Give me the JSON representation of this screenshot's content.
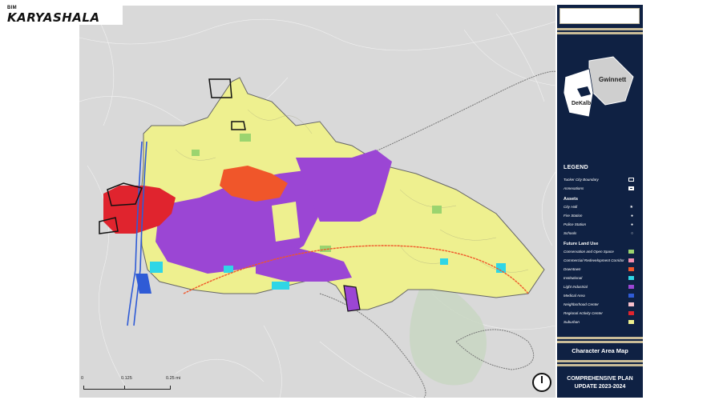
{
  "logo": {
    "small": "BIM",
    "name": "KARYASHALA"
  },
  "scale": {
    "ticks": [
      "0",
      "0.125",
      "0.25 mi"
    ]
  },
  "inset": {
    "county_a": "Gwinnett",
    "county_b": "DeKalb"
  },
  "legend": {
    "title": "LEGEND",
    "boundaries": [
      {
        "label": "Tucker City Boundary",
        "style": "outline"
      },
      {
        "label": "Annexations",
        "style": "outline-bold"
      }
    ],
    "assets_title": "Assets",
    "assets": [
      {
        "label": "City Hall",
        "symbol": "★"
      },
      {
        "label": "Fire Station",
        "symbol": "●"
      },
      {
        "label": "Police Station",
        "symbol": "●"
      },
      {
        "label": "Schools",
        "symbol": "○"
      }
    ],
    "landuse_title": "Future Land Use",
    "landuse": [
      {
        "label": "Conservation and Open Space",
        "color": "#9bd46f"
      },
      {
        "label": "Commercial Redevelopment Corridor",
        "color": "#f28fb0"
      },
      {
        "label": "Downtown",
        "color": "#f0562a"
      },
      {
        "label": "Institutional",
        "color": "#2fd6e6"
      },
      {
        "label": "Light Industrial",
        "color": "#9b46d4"
      },
      {
        "label": "Medical Area",
        "color": "#2f5bd6"
      },
      {
        "label": "Neighborhood Center",
        "color": "#f7c0cc"
      },
      {
        "label": "Regional Activity Center",
        "color": "#e0242e"
      },
      {
        "label": "Suburban",
        "color": "#eef08f"
      }
    ]
  },
  "panel": {
    "map_title": "Character Area Map",
    "plan_line1": "COMPREHENSIVE PLAN",
    "plan_line2": "UPDATE 2023-2024"
  },
  "colors": {
    "navy": "#0f2143",
    "gold": "#c9bc98",
    "base": "#d9d9d9"
  }
}
